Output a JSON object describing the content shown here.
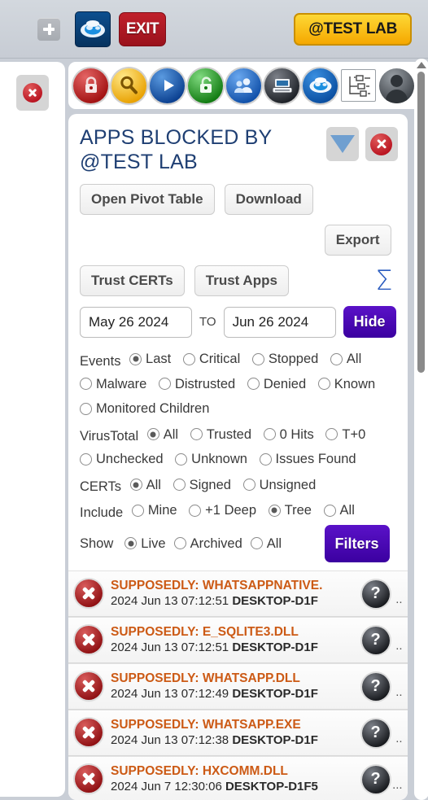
{
  "topbar": {
    "add_label": "+",
    "cloud_label": "cloud-logo",
    "exit_label": "EXIT",
    "lab_label": "@TEST LAB"
  },
  "leftcol": {
    "close_label": "close"
  },
  "toolbar": {
    "icons": [
      {
        "name": "lock-red-icon",
        "label": "Locked"
      },
      {
        "name": "magnifier-icon",
        "label": "Search"
      },
      {
        "name": "play-icon",
        "label": "Play"
      },
      {
        "name": "unlock-green-icon",
        "label": "Unlocked"
      },
      {
        "name": "users-icon",
        "label": "Users"
      },
      {
        "name": "computer-icon",
        "label": "Computers"
      },
      {
        "name": "cloud-eye-icon",
        "label": "Cloud"
      },
      {
        "name": "flowchart-icon",
        "label": "Tree"
      },
      {
        "name": "avatar-icon",
        "label": "Account"
      }
    ]
  },
  "panel": {
    "title": "APPS BLOCKED BY @TEST LAB",
    "collapse_label": "collapse",
    "close_label": "close",
    "buttons": {
      "pivot": "Open Pivot Table",
      "download": "Download",
      "export": "Export",
      "trust_certs": "Trust CERTs",
      "trust_apps": "Trust Apps",
      "sigma": "Σ",
      "hide": "Hide",
      "filters": "Filters"
    },
    "date_from": "May 26 2024",
    "date_to": "Jun 26 2024",
    "date_separator": "TO",
    "filters": [
      {
        "group": "Events",
        "options": [
          {
            "label": "Last",
            "selected": true
          },
          {
            "label": "Critical",
            "selected": false
          },
          {
            "label": "Stopped",
            "selected": false
          },
          {
            "label": "All",
            "selected": false
          },
          {
            "label": "Malware",
            "selected": false
          },
          {
            "label": "Distrusted",
            "selected": false
          },
          {
            "label": "Denied",
            "selected": false
          },
          {
            "label": "Known",
            "selected": false
          },
          {
            "label": "Monitored Children",
            "selected": false
          }
        ]
      },
      {
        "group": "VirusTotal",
        "options": [
          {
            "label": "All",
            "selected": true
          },
          {
            "label": "Trusted",
            "selected": false
          },
          {
            "label": "0 Hits",
            "selected": false
          },
          {
            "label": "T+0",
            "selected": false
          },
          {
            "label": "Unchecked",
            "selected": false
          },
          {
            "label": "Unknown",
            "selected": false
          },
          {
            "label": "Issues Found",
            "selected": false
          }
        ]
      },
      {
        "group": "CERTs",
        "options": [
          {
            "label": "All",
            "selected": true
          },
          {
            "label": "Signed",
            "selected": false
          },
          {
            "label": "Unsigned",
            "selected": false
          }
        ]
      },
      {
        "group": "Include",
        "options": [
          {
            "label": "Mine",
            "selected": false
          },
          {
            "label": "+1 Deep",
            "selected": false
          },
          {
            "label": "Tree",
            "selected": true
          },
          {
            "label": "All",
            "selected": false
          }
        ]
      },
      {
        "group": "Show",
        "options": [
          {
            "label": "Live",
            "selected": true
          },
          {
            "label": "Archived",
            "selected": false
          },
          {
            "label": "All",
            "selected": false
          }
        ]
      }
    ],
    "rows": [
      {
        "title": "SUPPOSEDLY: WHATSAPPNATIVE.",
        "detail_date": "2024 Jun 13 07:12:51",
        "detail_host": "DESKTOP-D1F",
        "trailing": ".."
      },
      {
        "title": "SUPPOSEDLY: E_SQLITE3.DLL",
        "detail_date": "2024 Jun 13 07:12:51",
        "detail_host": "DESKTOP-D1F",
        "trailing": ".."
      },
      {
        "title": "SUPPOSEDLY: WHATSAPP.DLL",
        "detail_date": "2024 Jun 13 07:12:49",
        "detail_host": "DESKTOP-D1F",
        "trailing": ".."
      },
      {
        "title": "SUPPOSEDLY: WHATSAPP.EXE",
        "detail_date": "2024 Jun 13 07:12:38",
        "detail_host": "DESKTOP-D1F",
        "trailing": ".."
      },
      {
        "title": "SUPPOSEDLY: HXCOMM.DLL",
        "detail_date": "2024 Jun 7 12:30:06",
        "detail_host": "DESKTOP-D1F5",
        "trailing": "..."
      }
    ],
    "row_help_label": "?"
  },
  "colors": {
    "title": "#1f3f73",
    "accent_purple": "#4a0fb4",
    "lab_gold": "#f5c400",
    "exit_red": "#ad1620",
    "row_title": "#cc5a15"
  }
}
